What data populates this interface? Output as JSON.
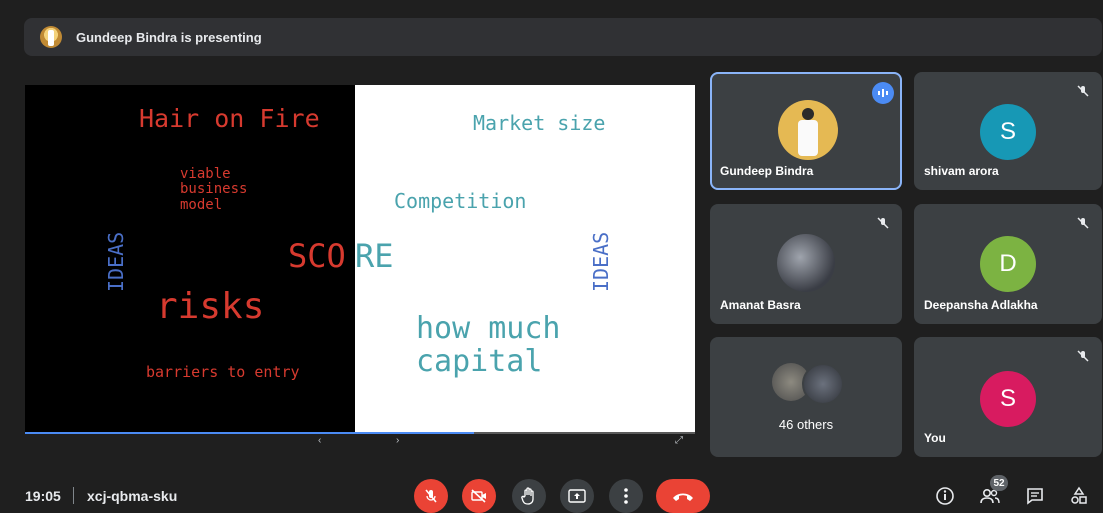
{
  "presenting_banner": "Gundeep Bindra is presenting",
  "slide": {
    "hair_on_fire": "Hair on Fire",
    "viable_business_model": "viable\nbusiness\nmodel",
    "ideas_left": "IDEAS",
    "score_left": "SCO",
    "score_right": "RE",
    "risks": "risks",
    "barriers": "barriers to entry",
    "market_size": "Market size",
    "competition": "Competition",
    "ideas_right": "IDEAS",
    "how_much_capital": "how much\ncapital",
    "progress": 0.67
  },
  "participants": [
    {
      "name": "Gundeep Bindra",
      "speaking": true
    },
    {
      "name": "shivam arora",
      "initial": "S",
      "color": "#1798b5",
      "muted": true
    },
    {
      "name": "Amanat Basra",
      "muted": true
    },
    {
      "name": "Deepansha Adlakha",
      "initial": "D",
      "color": "#7cb342",
      "muted": true
    },
    {
      "name": "46 others"
    },
    {
      "name": "You",
      "initial": "S",
      "color": "#d81b60",
      "muted": true
    }
  ],
  "meeting": {
    "time": "19:05",
    "code": "xcj-qbma-sku",
    "participant_count": "52"
  },
  "colors": {
    "accent": "#8ab4f8",
    "danger": "#ea4335",
    "tile": "#3c4043"
  }
}
